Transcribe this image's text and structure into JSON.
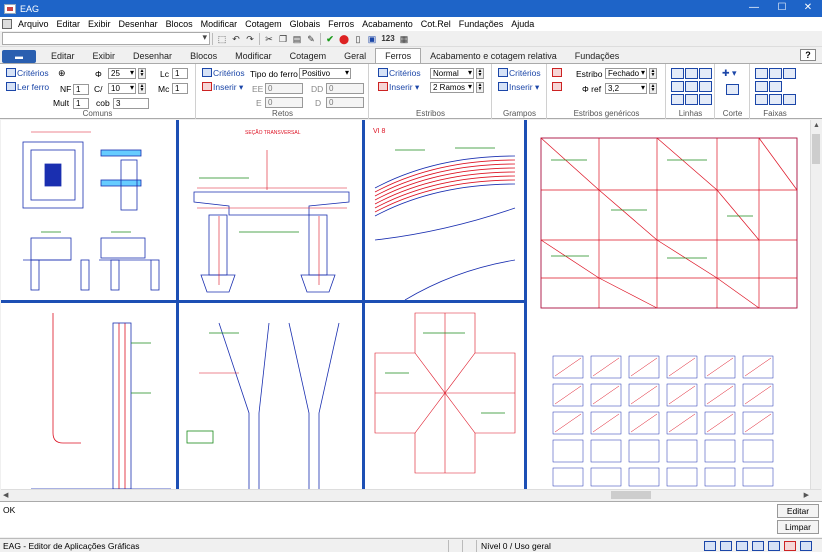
{
  "window": {
    "title": "EAG",
    "minimize": "—",
    "maximize": "☐",
    "close": "✕"
  },
  "menu": [
    "Arquivo",
    "Editar",
    "Exibir",
    "Desenhar",
    "Blocos",
    "Modificar",
    "Cotagem",
    "Globais",
    "Ferros",
    "Acabamento",
    "Cot.Rel",
    "Fundações",
    "Ajuda"
  ],
  "toolbar": {
    "layer_value": "",
    "number_label": "123"
  },
  "tabs": [
    {
      "label": "Editar",
      "active": false
    },
    {
      "label": "Exibir",
      "active": false
    },
    {
      "label": "Desenhar",
      "active": false
    },
    {
      "label": "Blocos",
      "active": false
    },
    {
      "label": "Modificar",
      "active": false
    },
    {
      "label": "Cotagem",
      "active": false
    },
    {
      "label": "Geral",
      "active": false
    },
    {
      "label": "Ferros",
      "active": true
    },
    {
      "label": "Acabamento e cotagem relativa",
      "active": false
    },
    {
      "label": "Fundações",
      "active": false
    }
  ],
  "help_label": "?",
  "ribbon": {
    "comuns": {
      "label": "Comuns",
      "criterios": "Critérios",
      "ler_ferro": "Ler ferro",
      "nf_label": "NF",
      "nf_value": "1",
      "mult_label": "Mult",
      "mult_value": "1",
      "phi_label": "Φ",
      "phi_value": "25",
      "c_label": "C/",
      "c_value": "10",
      "cob_label": "cob",
      "cob_value": "3",
      "lc_label": "Lc",
      "lc_value": "1",
      "mc_label": "Mc",
      "mc_value": "1"
    },
    "retos": {
      "label": "Retos",
      "criterios": "Critérios",
      "inserir": "Inserir",
      "tipo_label": "Tipo do ferro",
      "tipo_value": "Positivo",
      "ee_label": "EE",
      "ee_value": "0",
      "e_label": "E",
      "e_value": "0",
      "dd_label": "DD",
      "dd_value": "0",
      "d_label": "D",
      "d_value": "0"
    },
    "estribos": {
      "label": "Estribos",
      "criterios": "Critérios",
      "inserir": "Inserir",
      "tipo_value": "Normal",
      "ramos_value": "2 Ramos"
    },
    "grampos": {
      "label": "Grampos",
      "criterios": "Critérios",
      "inserir": "Inserir"
    },
    "estribos_genericos": {
      "label": "Estribos genéricos",
      "estribo_label": "Estribo",
      "estribo_value": "Fechado",
      "phi_ref_label": "Φ ref",
      "phi_ref_value": "3,2"
    },
    "linhas": {
      "label": "Linhas"
    },
    "corte": {
      "label": "Corte"
    },
    "faixas": {
      "label": "Faixas"
    }
  },
  "drawings": {
    "vp2_title": "SEÇÃO TRANSVERSAL",
    "vp3_title": "VI 8"
  },
  "command": {
    "output": "OK",
    "edit_label": "Editar",
    "clear_label": "Limpar"
  },
  "status": {
    "app": "EAG - Editor de Aplicações Gráficas",
    "level": "Nível 0 / Uso geral"
  },
  "colors": {
    "titlebar": "#1e64c8",
    "divider": "#1d4fb4",
    "accent": "#1b46a8"
  }
}
